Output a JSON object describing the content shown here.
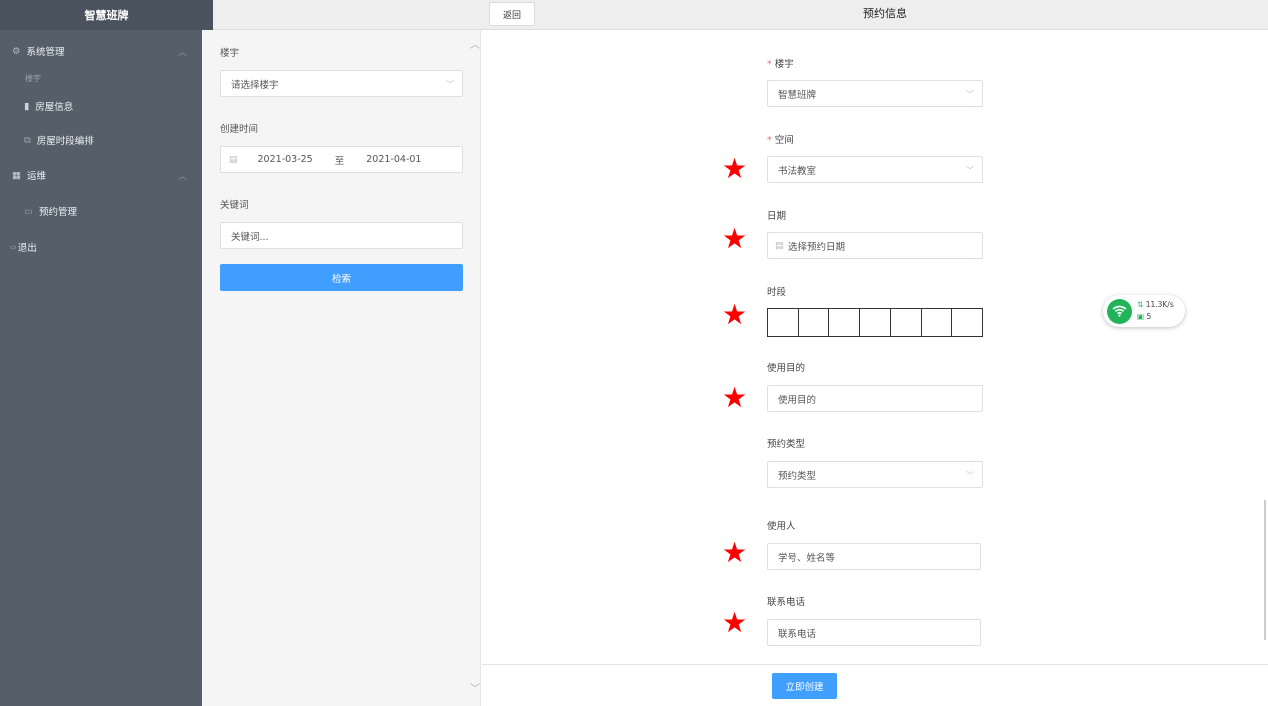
{
  "app": {
    "title": "智慧班牌"
  },
  "sidebar": {
    "system_group": "系统管理",
    "small_label": "楼宇",
    "items": [
      {
        "label": "房屋信息"
      },
      {
        "label": "房屋时段编排"
      }
    ],
    "ops_group": "运维",
    "ops_items": [
      {
        "label": "预约管理"
      }
    ],
    "logout": "退出"
  },
  "topbar": {
    "back_label": "返回",
    "title": "预约信息"
  },
  "filter": {
    "building_label": "楼宇",
    "building_placeholder": "请选择楼宇",
    "created_label": "创建时间",
    "date_start": "2021-03-25",
    "date_sep": "至",
    "date_end": "2021-04-01",
    "keyword_label": "关键词",
    "keyword_placeholder": "关键词...",
    "search_label": "检索"
  },
  "form": {
    "building_label": "楼宇",
    "building_value": "智慧班牌",
    "space_label": "空间",
    "space_value": "书法教室",
    "date_label": "日期",
    "date_placeholder": "选择预约日期",
    "period_label": "时段",
    "purpose_label": "使用目的",
    "purpose_placeholder": "使用目的",
    "type_label": "预约类型",
    "type_placeholder": "预约类型",
    "user_label": "使用人",
    "user_placeholder": "学号、姓名等",
    "phone_label": "联系电话",
    "phone_placeholder": "联系电话",
    "submit_label": "立即创建",
    "required_mark": "*",
    "star_mark": "★"
  },
  "network": {
    "speed": "11.3K/s",
    "count": "5"
  },
  "colors": {
    "sidebar": "#555f6a",
    "primary": "#409eff",
    "required": "#f56c6c",
    "star": "#ff0000"
  }
}
